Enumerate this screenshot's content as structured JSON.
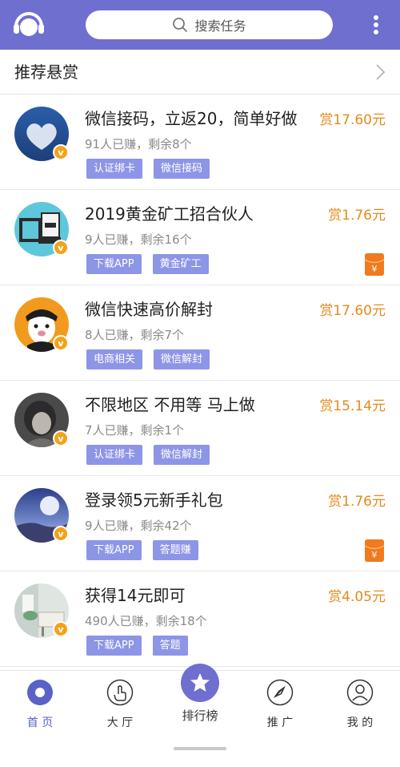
{
  "colors": {
    "brand": "#6f6fd0",
    "reward": "#e58a1a",
    "tag_bg": "#8d95e6",
    "badge": "#f3a21b",
    "redpacket": "#f07a1e"
  },
  "header": {
    "logo_icon": "headset-logo-icon",
    "search": {
      "icon": "search-icon",
      "placeholder": "搜索任务"
    },
    "more_icon": "more-vertical-icon"
  },
  "section": {
    "title": "推荐悬赏",
    "chevron_icon": "chevron-right-icon"
  },
  "tasks": [
    {
      "title": "微信接码，立返20，简单好做",
      "reward": "赏17.60元",
      "meta": "91人已赚，剩余8个",
      "tags": [
        "认证绑卡",
        "微信接码"
      ],
      "badge": "v",
      "redpacket": false
    },
    {
      "title": "2019黄金矿工招合伙人",
      "reward": "赏1.76元",
      "meta": "9人已赚，剩余16个",
      "tags": [
        "下载APP",
        "黄金矿工"
      ],
      "badge": "v",
      "redpacket": true,
      "redpacket_glyph": "¥"
    },
    {
      "title": "微信快速高价解封",
      "reward": "赏17.60元",
      "meta": "8人已赚，剩余7个",
      "tags": [
        "电商相关",
        "微信解封"
      ],
      "badge": "v",
      "redpacket": false
    },
    {
      "title": "不限地区 不用等 马上做",
      "reward": "赏15.14元",
      "meta": "7人已赚，剩余1个",
      "tags": [
        "认证绑卡",
        "微信解封"
      ],
      "badge": "v",
      "redpacket": false
    },
    {
      "title": "登录领5元新手礼包",
      "reward": "赏1.76元",
      "meta": "9人已赚，剩余42个",
      "tags": [
        "下载APP",
        "答题赚"
      ],
      "badge": "v",
      "redpacket": true,
      "redpacket_glyph": "¥"
    },
    {
      "title": "获得14元即可",
      "reward": "赏4.05元",
      "meta": "490人已赚，剩余18个",
      "tags": [
        "下载APP",
        "答题"
      ],
      "badge": "v",
      "redpacket": false
    }
  ],
  "nav": {
    "home": {
      "label": "首 页",
      "icon": "home-dot-icon"
    },
    "hall": {
      "label": "大 厅",
      "icon": "hand-tap-icon"
    },
    "rank": {
      "label": "排行榜",
      "icon": "star-icon"
    },
    "promote": {
      "label": "推 广",
      "icon": "compass-icon"
    },
    "mine": {
      "label": "我 的",
      "icon": "user-icon"
    }
  }
}
